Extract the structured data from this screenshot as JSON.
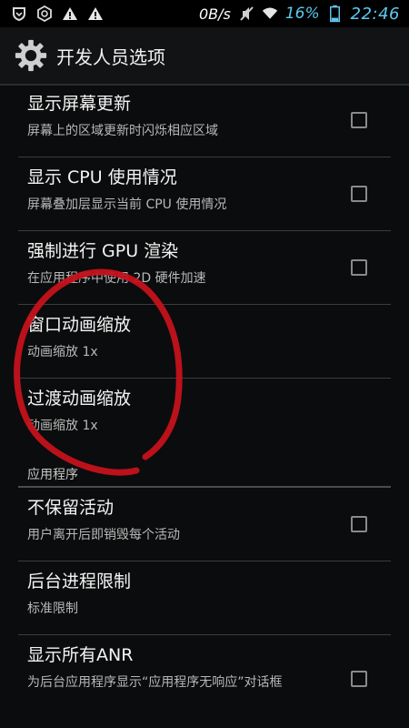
{
  "status_bar": {
    "speed": "0B/s",
    "battery_pct": "16%",
    "time": "22:46",
    "icons": [
      "shield-icon",
      "target-icon",
      "warning-icon",
      "warning-icon",
      "mute-icon",
      "wifi-icon",
      "battery-icon"
    ]
  },
  "action_bar": {
    "title": "开发人员选项",
    "icon": "gear-icon"
  },
  "items": [
    {
      "title": "显示屏幕更新",
      "summary": "屏幕上的区域更新时闪烁相应区域",
      "checked": false
    },
    {
      "title": "显示 CPU 使用情况",
      "summary": "屏幕叠加层显示当前 CPU 使用情况",
      "checked": false
    },
    {
      "title": "强制进行 GPU 渲染",
      "summary": "在应用程序中使用 2D 硬件加速",
      "checked": false
    },
    {
      "title": "窗口动画缩放",
      "summary": "动画缩放 1x"
    },
    {
      "title": "过渡动画缩放",
      "summary": "动画缩放 1x"
    }
  ],
  "section_header": "应用程序",
  "items2": [
    {
      "title": "不保留活动",
      "summary": "用户离开后即销毁每个活动",
      "checked": false
    },
    {
      "title": "后台进程限制",
      "summary": "标准限制"
    },
    {
      "title": "显示所有ANR",
      "summary": "为后台应用程序显示“应用程序无响应”对话框",
      "checked": false
    }
  ],
  "colors": {
    "accent": "#5fc8f0",
    "annotation": "#c4121c",
    "background": "#0b0c0d"
  }
}
